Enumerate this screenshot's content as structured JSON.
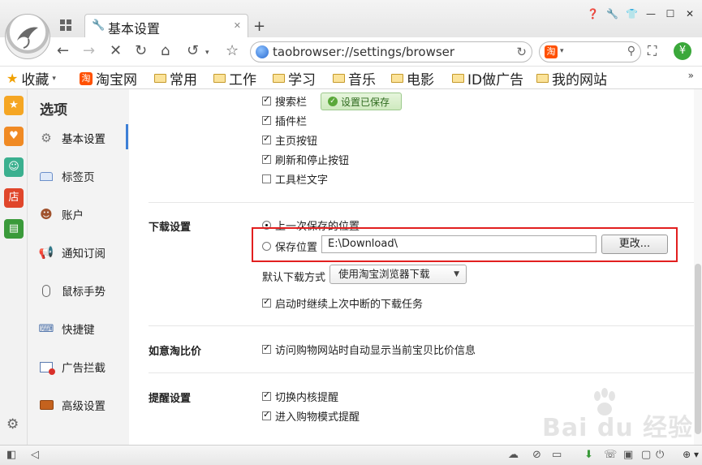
{
  "tab": {
    "title": "基本设置"
  },
  "address": {
    "url": "taobrowser://settings/browser"
  },
  "bookmarks": {
    "favorites_label": "收藏",
    "items": [
      {
        "label": "淘宝网"
      },
      {
        "label": "常用"
      },
      {
        "label": "工作"
      },
      {
        "label": "学习"
      },
      {
        "label": "音乐"
      },
      {
        "label": "电影"
      },
      {
        "label": "ID做广告"
      },
      {
        "label": "我的网站"
      }
    ]
  },
  "sidebar": {
    "title": "选项",
    "items": [
      {
        "label": "基本设置",
        "icon": "gear-icon"
      },
      {
        "label": "标签页",
        "icon": "tab-icon"
      },
      {
        "label": "账户",
        "icon": "user-icon"
      },
      {
        "label": "通知订阅",
        "icon": "megaphone-icon"
      },
      {
        "label": "鼠标手势",
        "icon": "mouse-icon"
      },
      {
        "label": "快捷键",
        "icon": "keyboard-icon"
      },
      {
        "label": "广告拦截",
        "icon": "ad-block-icon"
      },
      {
        "label": "高级设置",
        "icon": "briefcase-icon"
      }
    ]
  },
  "toolbar_section": {
    "items": [
      {
        "label": "搜索栏",
        "checked": true
      },
      {
        "label": "插件栏",
        "checked": true
      },
      {
        "label": "主页按钮",
        "checked": true
      },
      {
        "label": "刷新和停止按钮",
        "checked": true
      },
      {
        "label": "工具栏文字",
        "checked": false
      }
    ],
    "saved_badge": "设置已保存"
  },
  "download": {
    "section_label": "下载设置",
    "last_location_label": "上一次保存的位置",
    "save_location_label": "保存位置",
    "path_value": "E:\\Download\\",
    "change_button": "更改...",
    "default_method_label": "默认下载方式",
    "default_method_value": "使用淘宝浏览器下载",
    "resume_label": "启动时继续上次中断的下载任务"
  },
  "compare": {
    "section_label": "如意淘比价",
    "option_label": "访问购物网站时自动显示当前宝贝比价信息"
  },
  "reminder": {
    "section_label": "提醒设置",
    "items": [
      {
        "label": "切换内核提醒"
      },
      {
        "label": "进入购物模式提醒"
      }
    ]
  },
  "watermark": {
    "text": "Bai du 经验"
  },
  "colors": {
    "highlight_box": "#e21f1f",
    "active_bar": "#3d7fd6",
    "saved_green": "#2e6a1e"
  }
}
